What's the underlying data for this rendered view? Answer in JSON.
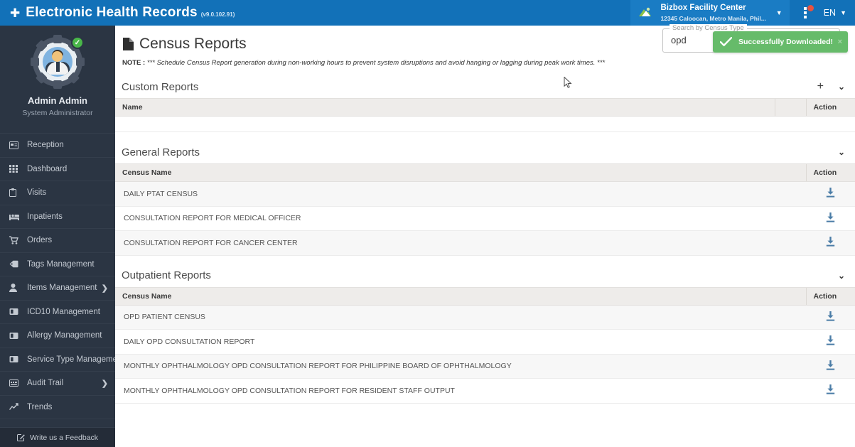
{
  "topbar": {
    "plus_icon": "plus-icon",
    "brand_title": "Electronic Health Records",
    "version": "(v9.0.102.91)",
    "facility": {
      "name": "Bizbox Facility Center",
      "address": "12345 Caloocan, Metro Manila, Phil...",
      "caret": "▼"
    },
    "menu_dots_icon": "more-vertical-icon",
    "language": "EN",
    "language_caret": "▼",
    "accent_color": "#1271b8",
    "notification_dot_color": "#e8523f"
  },
  "sidebar": {
    "user_name": "Admin Admin",
    "user_role": "System Administrator",
    "status_badge": "✓",
    "items": [
      {
        "label": "Reception",
        "icon": "card-icon",
        "chevron": ""
      },
      {
        "label": "Dashboard",
        "icon": "grid-icon",
        "chevron": ""
      },
      {
        "label": "Visits",
        "icon": "clipboard-icon",
        "chevron": ""
      },
      {
        "label": "Inpatients",
        "icon": "bed-icon",
        "chevron": ""
      },
      {
        "label": "Orders",
        "icon": "cart-icon",
        "chevron": ""
      },
      {
        "label": "Tags Management",
        "icon": "tag-icon",
        "chevron": ""
      },
      {
        "label": "Items Management",
        "icon": "person-icon",
        "chevron": "❯"
      },
      {
        "label": "ICD10 Management",
        "icon": "book-icon",
        "chevron": ""
      },
      {
        "label": "Allergy Management",
        "icon": "book-icon",
        "chevron": ""
      },
      {
        "label": "Service Type Management",
        "icon": "book-icon",
        "chevron": ""
      },
      {
        "label": "Audit Trail",
        "icon": "list-icon",
        "chevron": "❯"
      },
      {
        "label": "Trends",
        "icon": "chart-line-icon",
        "chevron": ""
      }
    ],
    "feedback_label": "Write us a Feedback",
    "feedback_icon": "edit-square-icon",
    "background_color": "#2b3543"
  },
  "page": {
    "title": "Census Reports",
    "title_icon": "document-icon",
    "note_label": "NOTE :",
    "note_text": "*** Schedule Census Report generation during non-working hours to prevent system disruptions and avoid hanging or lagging during peak work times. ***"
  },
  "search": {
    "legend": "Search by Census Type",
    "value": "opd",
    "icon": "search-icon"
  },
  "toast": {
    "message": "Successfully Downloaded!",
    "check_icon": "check-icon",
    "close_label": "×",
    "color": "#66bb6a"
  },
  "sections": [
    {
      "title": "Custom Reports",
      "plus": "+",
      "chevron": "⌄",
      "has_plus": true,
      "columns": [
        "Name",
        "",
        "Action"
      ],
      "rows": []
    },
    {
      "title": "General Reports",
      "plus": "",
      "chevron": "⌄",
      "has_plus": false,
      "columns": [
        "Census Name",
        "Action"
      ],
      "rows": [
        {
          "name": "DAILY PTAT CENSUS",
          "action_icon": "download-icon"
        },
        {
          "name": "CONSULTATION REPORT FOR MEDICAL OFFICER",
          "action_icon": "download-icon"
        },
        {
          "name": "CONSULTATION REPORT FOR CANCER CENTER",
          "action_icon": "download-icon"
        }
      ]
    },
    {
      "title": "Outpatient Reports",
      "plus": "",
      "chevron": "⌄",
      "has_plus": false,
      "columns": [
        "Census Name",
        "Action"
      ],
      "rows": [
        {
          "name": "OPD PATIENT CENSUS",
          "action_icon": "download-icon"
        },
        {
          "name": "DAILY OPD CONSULTATION REPORT",
          "action_icon": "download-icon"
        },
        {
          "name": "MONTHLY OPHTHALMOLOGY OPD CONSULTATION REPORT FOR PHILIPPINE BOARD OF OPHTHALMOLOGY",
          "action_icon": "download-icon"
        },
        {
          "name": "MONTHLY OPHTHALMOLOGY OPD CONSULTATION REPORT FOR RESIDENT STAFF OUTPUT",
          "action_icon": "download-icon"
        }
      ]
    }
  ]
}
